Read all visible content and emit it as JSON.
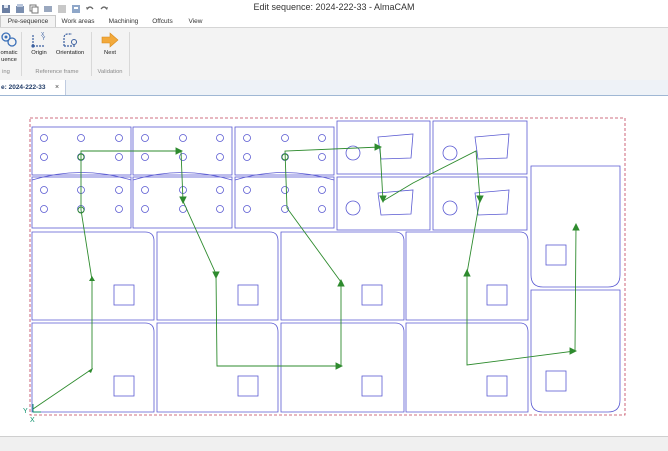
{
  "window": {
    "title": "Edit sequence: 2024-222-33 - AlmaCAM"
  },
  "tabs": [
    {
      "label": "Pre-sequence",
      "active": true
    },
    {
      "label": "Work areas",
      "active": false
    },
    {
      "label": "Machining",
      "active": false
    },
    {
      "label": "Offcuts",
      "active": false
    },
    {
      "label": "View",
      "active": false
    }
  ],
  "ribbon": {
    "automatic_label_1": "omatic",
    "automatic_label_2": "uence",
    "sequencing_group": "ing",
    "origin_label": "Origin",
    "orientation_label": "Orientation",
    "reference_frame_group": "Reference frame",
    "next_label": "Next",
    "validation_group": "Validation"
  },
  "document": {
    "tab_label": "e: 2024-222-33",
    "close_symbol": "×"
  },
  "axes": {
    "y_label": "Y",
    "x_label": "X"
  },
  "colors": {
    "part_outline": "#5a5ad2",
    "sheet_border": "#c0405a",
    "sequence_path": "#2e8b2e",
    "axis": "#0a8f6a",
    "next_arrow": "#f2a93b"
  }
}
